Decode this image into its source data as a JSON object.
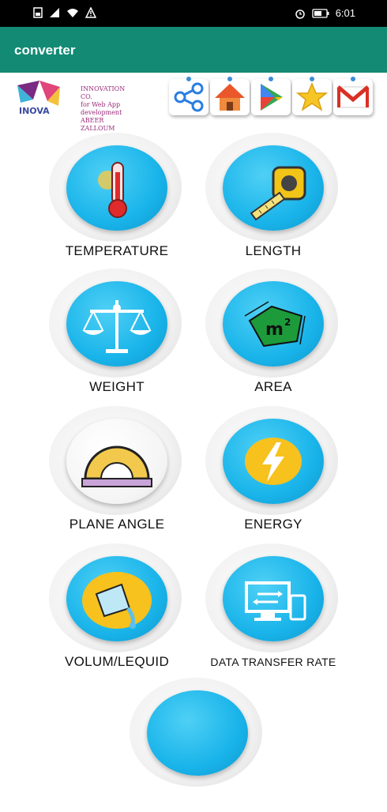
{
  "status_bar": {
    "time": "6:01"
  },
  "app_bar": {
    "title": "converter"
  },
  "banner": {
    "logo_text": "INOVA",
    "company_lines": [
      "INNOVATION CO.",
      "for Web App",
      "development",
      "ABEER ZALLOUM"
    ],
    "quick_actions": [
      "share-icon",
      "home-icon",
      "play-store-icon",
      "star-icon",
      "gmail-icon"
    ]
  },
  "categories": [
    {
      "label": "TEMPERATURE",
      "icon": "thermometer-icon"
    },
    {
      "label": "LENGTH",
      "icon": "tape-measure-icon"
    },
    {
      "label": "WEIGHT",
      "icon": "balance-scale-icon"
    },
    {
      "label": "AREA",
      "icon": "area-m2-icon"
    },
    {
      "label": "PLANE ANGLE",
      "icon": "protractor-icon"
    },
    {
      "label": "ENERGY",
      "icon": "lightning-icon"
    },
    {
      "label": "VOLUM/LEQUID",
      "icon": "liquid-pour-icon"
    },
    {
      "label": "DATA TRANSFER RATE",
      "icon": "data-transfer-icon"
    }
  ],
  "colors": {
    "app_bar": "#138a74",
    "disc": "#19b4ea"
  }
}
